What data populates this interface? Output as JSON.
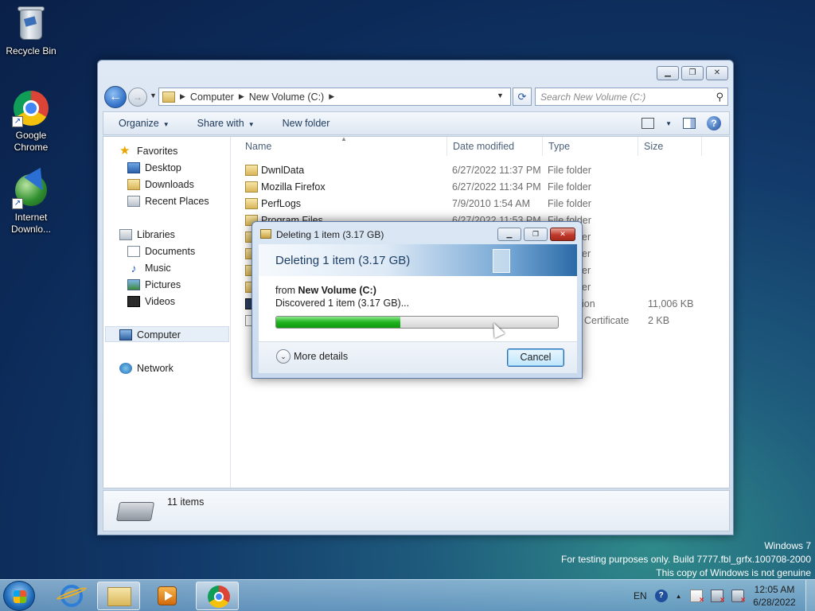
{
  "desktop": {
    "icons": [
      {
        "label": "Recycle Bin",
        "icon": "recycle-bin-icon"
      },
      {
        "label": "Google Chrome",
        "icon": "chrome-icon"
      },
      {
        "label": "Internet Downlo...",
        "icon": "idm-icon"
      }
    ]
  },
  "explorer": {
    "breadcrumb": [
      "Computer",
      "New Volume (C:)"
    ],
    "search_placeholder": "Search New Volume (C:)",
    "commands": {
      "organize": "Organize",
      "share_with": "Share with",
      "new_folder": "New folder"
    },
    "nav": {
      "favorites": "Favorites",
      "desktop": "Desktop",
      "downloads": "Downloads",
      "recent_places": "Recent Places",
      "libraries": "Libraries",
      "documents": "Documents",
      "music": "Music",
      "pictures": "Pictures",
      "videos": "Videos",
      "computer": "Computer",
      "network": "Network"
    },
    "columns": {
      "name": "Name",
      "date": "Date modified",
      "type": "Type",
      "size": "Size"
    },
    "files": [
      {
        "name": "DwnlData",
        "date": "6/27/2022 11:37 PM",
        "type": "File folder",
        "size": ""
      },
      {
        "name": "Mozilla Firefox",
        "date": "6/27/2022 11:34 PM",
        "type": "File folder",
        "size": ""
      },
      {
        "name": "PerfLogs",
        "date": "7/9/2010 1:54 AM",
        "type": "File folder",
        "size": ""
      },
      {
        "name": "Program Files",
        "date": "6/27/2022 11:53 PM",
        "type": "File folder",
        "size": ""
      },
      {
        "name": "",
        "date": "",
        "type": "ion",
        "size": "11,006 KB"
      },
      {
        "name": "",
        "date": "",
        "type": "Certificate",
        "size": "2 KB"
      }
    ],
    "partial_types": [
      "er",
      "er",
      "er",
      "er"
    ],
    "status": "11 items"
  },
  "dialog": {
    "title": "Deleting 1 item (3.17 GB)",
    "header": "Deleting 1 item (3.17 GB)",
    "from_prefix": "from",
    "from_location": "New Volume (C:)",
    "discovered": "Discovered 1 item (3.17 GB)...",
    "progress_percent": 44,
    "more_details": "More details",
    "cancel": "Cancel"
  },
  "watermark": {
    "line1": "Windows 7",
    "line2": "For testing purposes only. Build 7777.fbl_grfx.100708-2000",
    "line3": "This copy of Windows is not genuine"
  },
  "taskbar": {
    "language": "EN",
    "time": "12:05 AM",
    "date": "6/28/2022"
  },
  "colors": {
    "progress": "#1fb31f",
    "accent": "#2d6ab0"
  }
}
